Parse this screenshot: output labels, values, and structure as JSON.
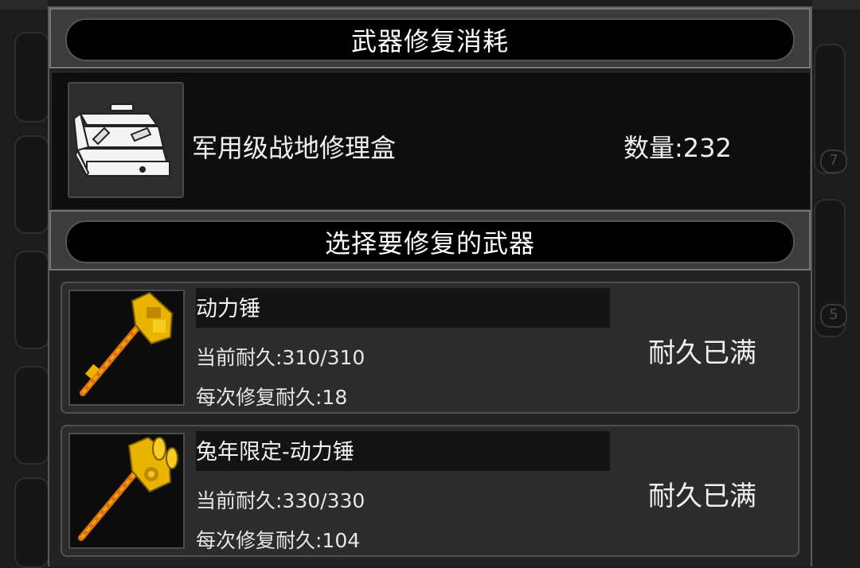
{
  "dialog": {
    "cost_title": "武器修复消耗",
    "select_title": "选择要修复的武器"
  },
  "consumable": {
    "name": "军用级战地修理盒",
    "quantity": "数量:232",
    "icon": "toolbox-icon"
  },
  "weapons": [
    {
      "name": "动力锤",
      "durability": "当前耐久:310/310",
      "repair_per_use": "每次修复耐久:18",
      "status": "耐久已满",
      "icon": "power-hammer-icon"
    },
    {
      "name": "兔年限定-动力锤",
      "durability": "当前耐久:330/330",
      "repair_per_use": "每次修复耐久:104",
      "status": "耐久已满",
      "icon": "rabbit-power-hammer-icon"
    }
  ],
  "background": {
    "badges": [
      "7",
      "5"
    ]
  },
  "colors": {
    "hammer_gold": "#e8b400",
    "hammer_orange": "#e07010",
    "panel_dark": "#0e0e0e"
  }
}
